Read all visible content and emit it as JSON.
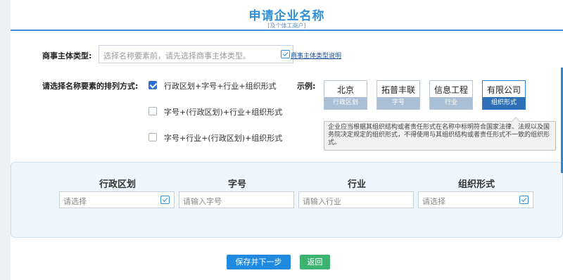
{
  "header": {
    "title": "申请企业名称",
    "subtitle": "[及个体工商户]"
  },
  "entity_type": {
    "label": "商事主体类型:",
    "placeholder": "选择名称要素前，请先选择商事主体类型。",
    "help_link": "商事主体类型说明"
  },
  "arrangement": {
    "label": "请选择名称要素的排列方式:",
    "options": [
      {
        "label": "行政区划+字号+行业+组织形式",
        "checked": true
      },
      {
        "label": "字号+(行政区划)+行业+组织形式",
        "checked": false
      },
      {
        "label": "字号+行业+(行政区划)+组织形式",
        "checked": false
      }
    ]
  },
  "example": {
    "label": "示例:",
    "cards": [
      {
        "main": "北京",
        "sub": "行政区划"
      },
      {
        "main": "拓普丰联",
        "sub": "字号"
      },
      {
        "main": "信息工程",
        "sub": "行业"
      },
      {
        "main": "有限公司",
        "sub": "组织形式"
      }
    ],
    "tooltip": "企业应当根据其组织结构或者责任形式在名称中标明符合国家法律、法规以及国务院决定规定的组织形式，不得使用与其组织结构或者责任形式不一致的组织形式。"
  },
  "elements": [
    {
      "header": "行政区划",
      "placeholder": "请选择"
    },
    {
      "header": "字号",
      "placeholder": "请输入字号"
    },
    {
      "header": "行业",
      "placeholder": "请输入行业"
    },
    {
      "header": "组织形式",
      "placeholder": "请选择"
    }
  ],
  "buttons": {
    "save": "保存并下一步",
    "back": "返回"
  },
  "colors": {
    "accent": "#2f8fd8",
    "save": "#1f8ae0",
    "back": "#3cb371"
  }
}
